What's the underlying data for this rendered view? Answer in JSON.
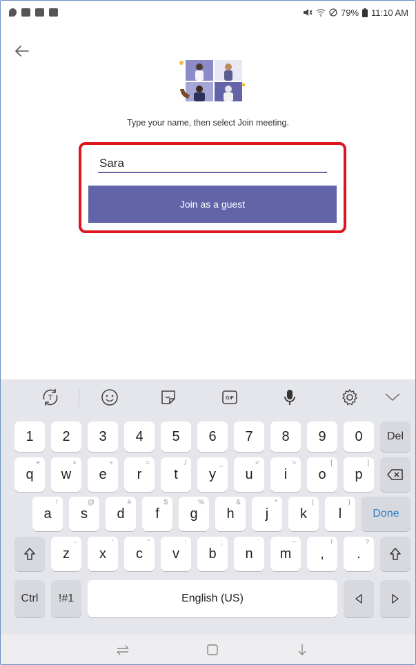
{
  "status_bar": {
    "battery": "79%",
    "time": "11:10 AM"
  },
  "join": {
    "instruction": "Type your name, then select Join meeting.",
    "name_value": "Sara",
    "button_label": "Join as a guest"
  },
  "keyboard": {
    "row_numbers": [
      {
        "label": "1"
      },
      {
        "label": "2"
      },
      {
        "label": "3"
      },
      {
        "label": "4"
      },
      {
        "label": "5"
      },
      {
        "label": "6"
      },
      {
        "label": "7"
      },
      {
        "label": "8"
      },
      {
        "label": "9"
      },
      {
        "label": "0"
      }
    ],
    "del_label": "Del",
    "row_q": [
      {
        "label": "q",
        "hint": "+"
      },
      {
        "label": "w",
        "hint": "×"
      },
      {
        "label": "e",
        "hint": "÷"
      },
      {
        "label": "r",
        "hint": "="
      },
      {
        "label": "t",
        "hint": "/"
      },
      {
        "label": "y",
        "hint": "_"
      },
      {
        "label": "u",
        "hint": "<"
      },
      {
        "label": "i",
        "hint": ">"
      },
      {
        "label": "o",
        "hint": "["
      },
      {
        "label": "p",
        "hint": "]"
      }
    ],
    "row_a": [
      {
        "label": "a",
        "hint": "!"
      },
      {
        "label": "s",
        "hint": "@"
      },
      {
        "label": "d",
        "hint": "#"
      },
      {
        "label": "f",
        "hint": "$"
      },
      {
        "label": "g",
        "hint": "%"
      },
      {
        "label": "h",
        "hint": "&"
      },
      {
        "label": "j",
        "hint": "*"
      },
      {
        "label": "k",
        "hint": "("
      },
      {
        "label": "l",
        "hint": ")"
      }
    ],
    "done_label": "Done",
    "row_z": [
      {
        "label": "z",
        "hint": "-"
      },
      {
        "label": "x",
        "hint": "'"
      },
      {
        "label": "c",
        "hint": "\""
      },
      {
        "label": "v",
        "hint": ":"
      },
      {
        "label": "b",
        "hint": ";"
      },
      {
        "label": "n",
        "hint": "`"
      },
      {
        "label": "m",
        "hint": "~"
      }
    ],
    "comma_label": ",",
    "comma_hint": "!",
    "period_label": ".",
    "period_hint": "?",
    "ctrl_label": "Ctrl",
    "symbols_label": "!#1",
    "space_label": "English (US)"
  },
  "colors": {
    "accent": "#6264a7",
    "highlight": "#e0141e",
    "keyboard_bg": "#e5e6eb",
    "done_text": "#2f7fc6"
  }
}
